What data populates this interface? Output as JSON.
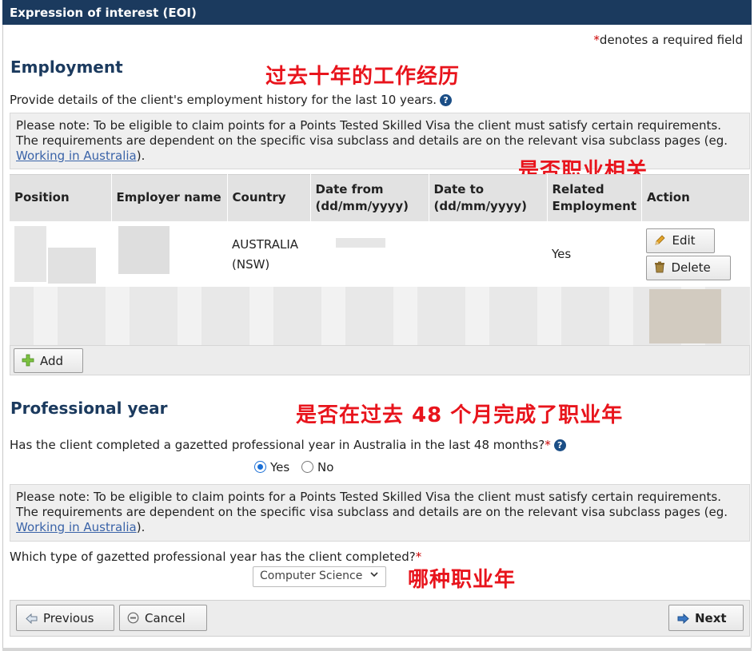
{
  "window": {
    "title": "Expression of interest (EOI)"
  },
  "required_note": {
    "asterisk": "*",
    "text": "denotes a required field"
  },
  "employment": {
    "heading": "Employment",
    "description": "Provide details of the client's employment history for the last 10 years.",
    "help_glyph": "?",
    "note_prefix": "Please note: To be eligible to claim points for a Points Tested Skilled Visa the client must satisfy certain requirements. The requirements are dependent on the specific visa subclass and details are on the relevant visa subclass pages (eg. ",
    "note_link": "Working in Australia",
    "note_suffix": ").",
    "table": {
      "headers": [
        "Position",
        "Employer name",
        "Country",
        "Date from (dd/mm/yyyy)",
        "Date to (dd/mm/yyyy)",
        "Related Employment",
        "Action"
      ],
      "row": {
        "country": "AUSTRALIA (NSW)",
        "related": "Yes",
        "edit_label": "Edit",
        "delete_label": "Delete"
      }
    },
    "add_label": "Add"
  },
  "professional_year": {
    "heading": "Professional year",
    "question": "Has the client completed a gazetted professional year in Australia in the last 48 months?",
    "asterisk": "*",
    "help_glyph": "?",
    "options": {
      "yes": "Yes",
      "no": "No",
      "selected": "Yes"
    },
    "note_prefix": "Please note: To be eligible to claim points for a Points Tested Skilled Visa the client must satisfy certain requirements. The requirements are dependent on the specific visa subclass and details are on the relevant visa subclass pages (eg. ",
    "note_link": "Working in Australia",
    "note_suffix": ").",
    "type_question": "Which type of gazetted professional year has the client completed?",
    "type_asterisk": "*",
    "type_selected": "Computer Science"
  },
  "footer": {
    "previous": "Previous",
    "cancel": "Cancel",
    "next": "Next"
  },
  "annotations": {
    "employment": "过去十年的工作经历",
    "related": "是否职业相关",
    "professional_year": "是否在过去 48 个月完成了职业年",
    "type": "哪种职业年"
  },
  "colors": {
    "titlebar": "#1b3a5e",
    "heading": "#1b3a5e",
    "annotation": "#e8141c",
    "link": "#3a63a8"
  }
}
